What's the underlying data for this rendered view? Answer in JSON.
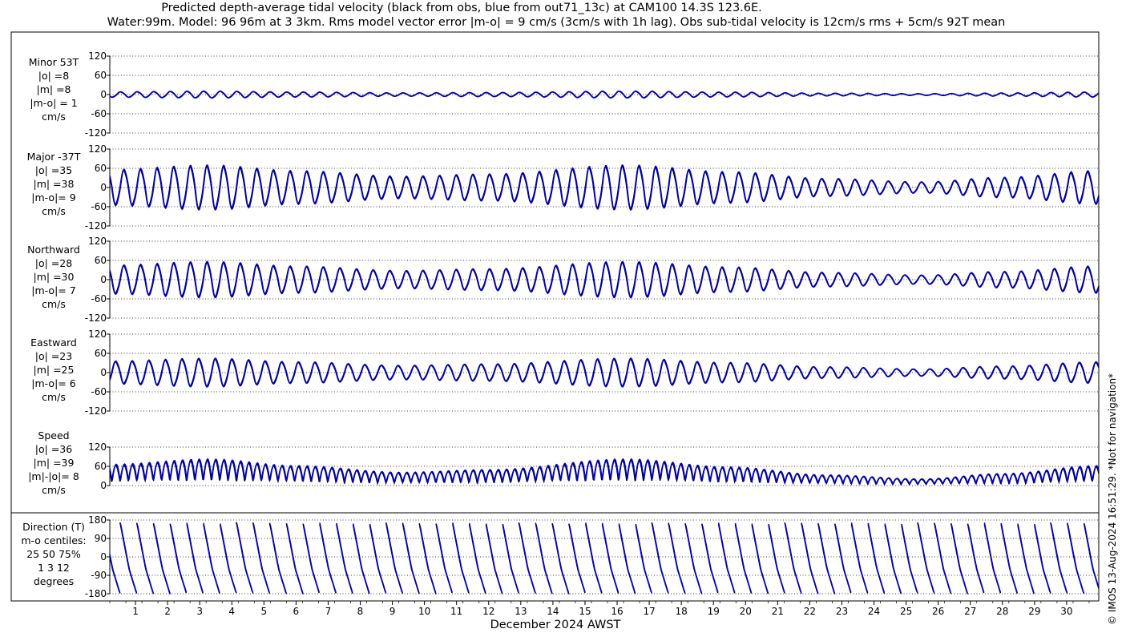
{
  "title_line1": "Predicted depth-average tidal velocity (black from obs, blue from out71_13c) at CAM100 14.3S 123.6E.",
  "title_line2": "Water:99m. Model: 96 96m at 3 3km. Rms model vector error |m-o| = 9 cm/s (3cm/s with 1h lag). Obs sub-tidal velocity is 12cm/s rms + 5cm/s 92T mean",
  "xlabel": "December 2024 AWST",
  "credit": "© IMOS 13-Aug-2024 16:51:29. *Not for navigation*",
  "colors": {
    "obs": "#000000",
    "model": "#0000cc",
    "grid": "#000000"
  },
  "chart_data": {
    "type": "line",
    "x_unit": "day of December 2024 (AWST)",
    "x_ticks": [
      1,
      2,
      3,
      4,
      5,
      6,
      7,
      8,
      9,
      10,
      11,
      12,
      13,
      14,
      15,
      16,
      17,
      18,
      19,
      20,
      21,
      22,
      23,
      24,
      25,
      26,
      27,
      28,
      29,
      30
    ],
    "xlim": [
      0.2,
      31.0
    ],
    "panels": [
      {
        "id": "minor",
        "label_lines": [
          "Minor 53T",
          "|o| =8",
          "|m| =8",
          "|m-o| = 1",
          "cm/s"
        ],
        "ylim": [
          -120,
          120
        ],
        "yticks": [
          "120",
          "60",
          "0",
          "-60",
          "-120"
        ],
        "ytick_values": [
          120,
          60,
          0,
          -60,
          -120
        ],
        "mode": "osc",
        "amp": 11,
        "phase": 1.3,
        "series": [
          "obs (black)",
          "model (blue)"
        ]
      },
      {
        "id": "major",
        "label_lines": [
          "Major -37T",
          "|o| =35",
          "|m| =38",
          "|m-o|= 9",
          "cm/s"
        ],
        "ylim": [
          -120,
          120
        ],
        "yticks": [
          "120",
          "60",
          "0",
          "-60",
          "-120"
        ],
        "ytick_values": [
          120,
          60,
          0,
          -60,
          -120
        ],
        "mode": "osc",
        "amp": 72,
        "phase": 0.0,
        "series": [
          "obs (black)",
          "model (blue)"
        ]
      },
      {
        "id": "north",
        "label_lines": [
          "Northward",
          "|o| =28",
          "|m| =30",
          "|m-o|= 7",
          "cm/s"
        ],
        "ylim": [
          -120,
          120
        ],
        "yticks": [
          "120",
          "60",
          "0",
          "-60",
          "-120"
        ],
        "ytick_values": [
          120,
          60,
          0,
          -60,
          -120
        ],
        "mode": "osc",
        "amp": 58,
        "phase": 0.0,
        "series": [
          "obs (black)",
          "model (blue)"
        ]
      },
      {
        "id": "east",
        "label_lines": [
          "Eastward",
          "|o| =23",
          "|m| =25",
          "|m-o|= 6",
          "cm/s"
        ],
        "ylim": [
          -120,
          120
        ],
        "yticks": [
          "120",
          "60",
          "0",
          "-60",
          "-120"
        ],
        "ytick_values": [
          120,
          60,
          0,
          -60,
          -120
        ],
        "mode": "osc",
        "amp": 46,
        "phase": 3.1416,
        "series": [
          "obs (black)",
          "model (blue)"
        ]
      },
      {
        "id": "speed",
        "label_lines": [
          "Speed",
          "|o| =36",
          "|m| =39",
          "|m|-|o|= 8",
          "cm/s"
        ],
        "ylim": [
          0,
          120
        ],
        "yticks": [
          "120",
          "60",
          "0"
        ],
        "ytick_values": [
          120,
          60,
          0
        ],
        "mode": "speed",
        "amp": 78,
        "phase": 0.0,
        "series": [
          "obs (black)",
          "model (blue)"
        ]
      },
      {
        "id": "direction",
        "label_lines": [
          "Direction (T)",
          "m-o centiles:",
          "25  50  75%",
          "1   3   12",
          "degrees"
        ],
        "ylim": [
          -180,
          180
        ],
        "yticks": [
          "180",
          "90",
          "0",
          "-90",
          "-180"
        ],
        "ytick_values": [
          180,
          90,
          0,
          -90,
          -180
        ],
        "mode": "dir",
        "amp": 180,
        "phase": 0.0,
        "series": [
          "obs (black)",
          "model (blue)"
        ]
      }
    ],
    "tidal_envelope": {
      "description": "spring-neap modulation of amplitude fraction by day",
      "days": [
        0.2,
        3.3,
        6.0,
        9.3,
        12.0,
        16.3,
        19.5,
        22.5,
        25.5,
        28.0,
        31.0
      ],
      "fraction": [
        0.8,
        1.0,
        0.75,
        0.5,
        0.6,
        1.0,
        0.7,
        0.4,
        0.25,
        0.45,
        0.75
      ]
    }
  }
}
